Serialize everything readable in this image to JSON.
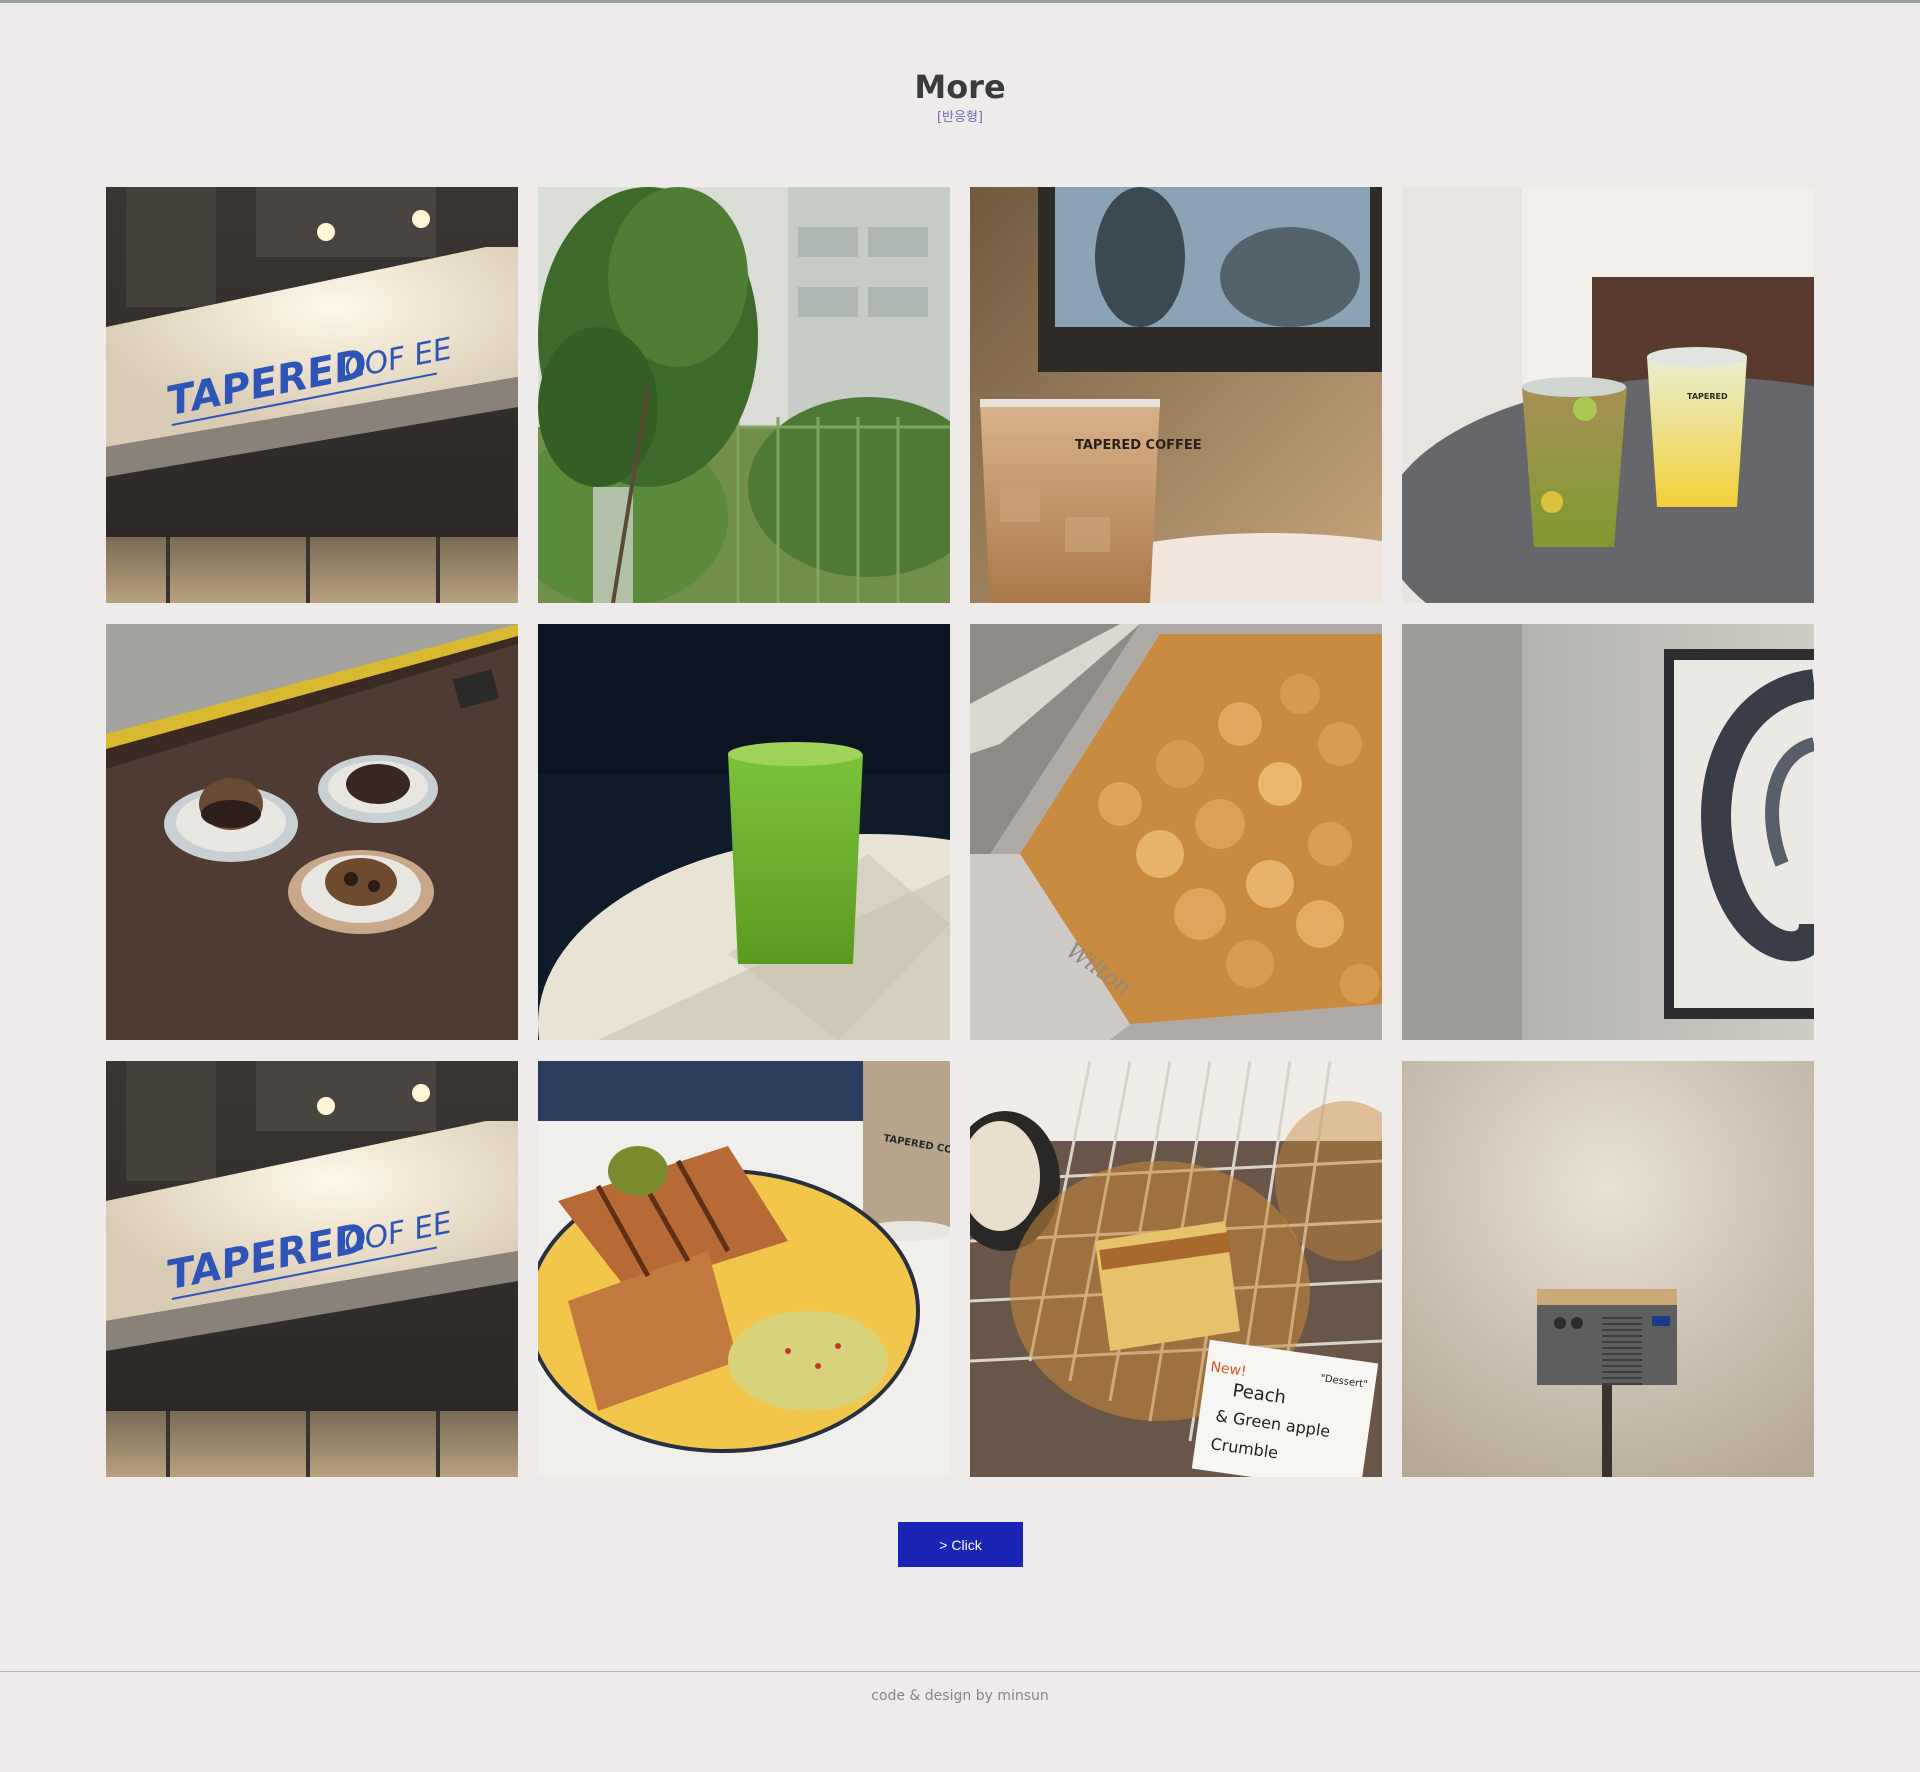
{
  "header": {
    "title": "More",
    "subtitle": "[반응형]"
  },
  "gallery": {
    "photos": [
      {
        "subject": "tapered-coffee-sign",
        "sign_text": "TAPERED",
        "sign_text_2": "COF EE"
      },
      {
        "subject": "potted-tree-by-window"
      },
      {
        "subject": "iced-latte-cup",
        "cup_text": "TAPERED COFFEE"
      },
      {
        "subject": "two-iced-teas",
        "cup_text": "TAPERED"
      },
      {
        "subject": "cookies-on-plates"
      },
      {
        "subject": "green-juice-glass"
      },
      {
        "subject": "crumble-in-baking-pan",
        "pan_text": "Wilton"
      },
      {
        "subject": "framed-art-on-wall"
      },
      {
        "subject": "tapered-coffee-sign",
        "sign_text": "TAPERED",
        "sign_text_2": "COF EE"
      },
      {
        "subject": "panini-with-salad",
        "cup_text": "TAPERED COFFEE"
      },
      {
        "subject": "pastries-on-cooling-rack",
        "tag_new": "New!",
        "tag_text_1": "Peach",
        "tag_text_2": "& Green apple",
        "tag_text_3": "Crumble",
        "tag_text_4": "\"Dessert\""
      },
      {
        "subject": "radio-speaker-on-stand"
      }
    ]
  },
  "cta": {
    "label": "> Click"
  },
  "footer": {
    "credit": "code & design by minsun"
  },
  "colors": {
    "background": "#f0ebeb",
    "button": "#1b25b5",
    "subtitle": "#6b6fb0"
  }
}
